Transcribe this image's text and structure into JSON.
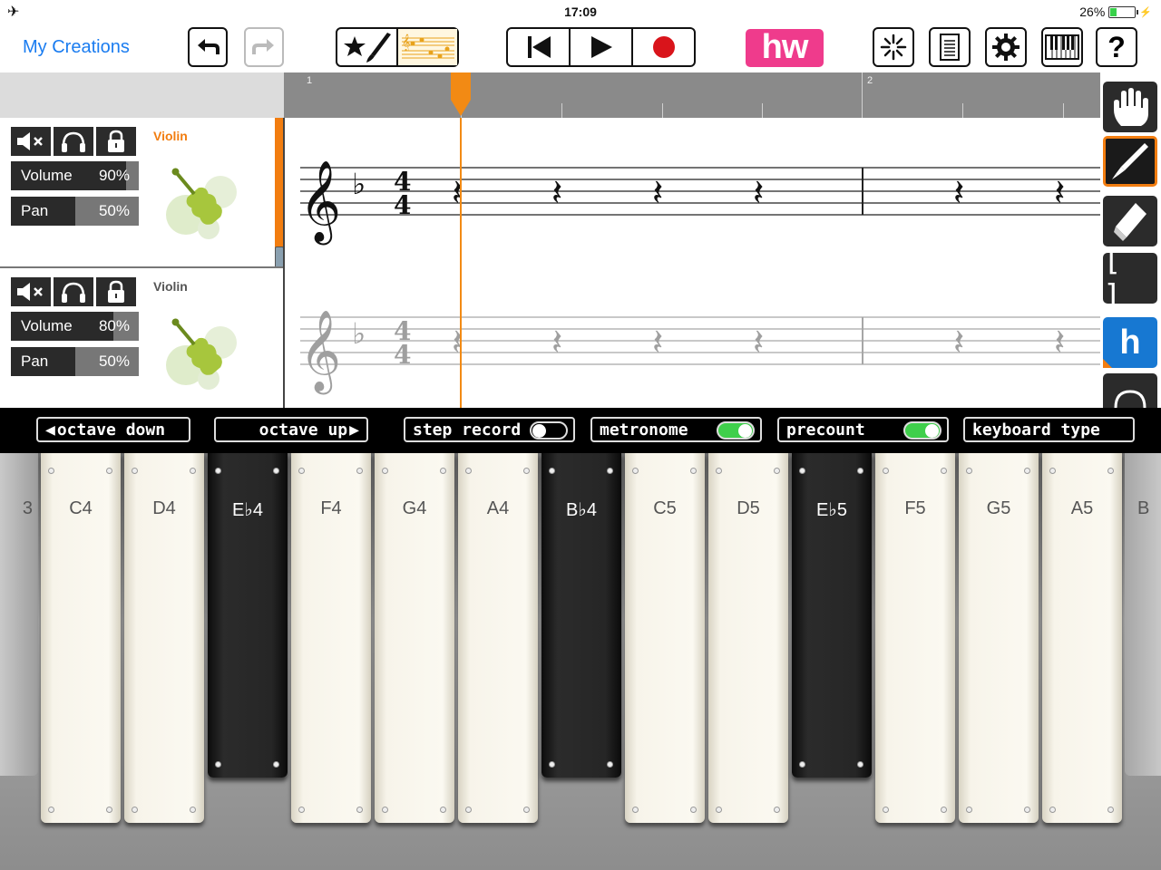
{
  "status": {
    "time": "17:09",
    "battery": "26%",
    "battery_level": 0.26
  },
  "toolbar": {
    "back_label": "My Creations",
    "icons": [
      "undo-icon",
      "redo-icon",
      "star-brush-icon",
      "score-icon",
      "rewind-icon",
      "play-icon",
      "record-icon",
      "hw-logo",
      "sparkle-icon",
      "sheet-icon",
      "gear-icon",
      "keyboard-icon",
      "help-icon"
    ],
    "hw_label": "hw",
    "help_label": "?"
  },
  "ruler": {
    "bar1": "1",
    "bar2": "2"
  },
  "tracks": [
    {
      "name": "Violin",
      "name_color": "#f27d10",
      "volume_label": "Volume",
      "volume_value": "90%",
      "volume_level": 0.9,
      "pan_label": "Pan",
      "pan_value": "50%",
      "pan_level": 0.5
    },
    {
      "name": "Violin",
      "name_color": "#555555",
      "volume_label": "Volume",
      "volume_value": "80%",
      "volume_level": 0.8,
      "pan_label": "Pan",
      "pan_value": "50%",
      "pan_level": 0.5
    }
  ],
  "tools": [
    "hand-icon",
    "pen-icon",
    "eraser-icon",
    "bracket-icon",
    "h-icon",
    "circle-icon"
  ],
  "tools_text": {
    "bracket": "[ ]",
    "h": "h"
  },
  "options": {
    "octave_down": "octave down",
    "octave_up": "octave up",
    "step_record": "step record",
    "metronome": "metronome",
    "precount": "precount",
    "keyboard_type": "keyboard type",
    "step_record_on": false,
    "metronome_on": true,
    "precount_on": true
  },
  "keys": [
    {
      "label": "3",
      "color": "grey"
    },
    {
      "label": "C4",
      "color": "white"
    },
    {
      "label": "D4",
      "color": "white"
    },
    {
      "label": "E♭4",
      "color": "black"
    },
    {
      "label": "F4",
      "color": "white"
    },
    {
      "label": "G4",
      "color": "white"
    },
    {
      "label": "A4",
      "color": "white"
    },
    {
      "label": "B♭4",
      "color": "black"
    },
    {
      "label": "C5",
      "color": "white"
    },
    {
      "label": "D5",
      "color": "white"
    },
    {
      "label": "E♭5",
      "color": "black"
    },
    {
      "label": "F5",
      "color": "white"
    },
    {
      "label": "G5",
      "color": "white"
    },
    {
      "label": "A5",
      "color": "white"
    },
    {
      "label": "B",
      "color": "grey"
    }
  ],
  "colors": {
    "accent": "#f27d10",
    "link": "#1a7cf0",
    "hw_brand": "#ef3b8c",
    "toggle_on": "#3fcf4b",
    "tool_blue": "#1778d2"
  }
}
